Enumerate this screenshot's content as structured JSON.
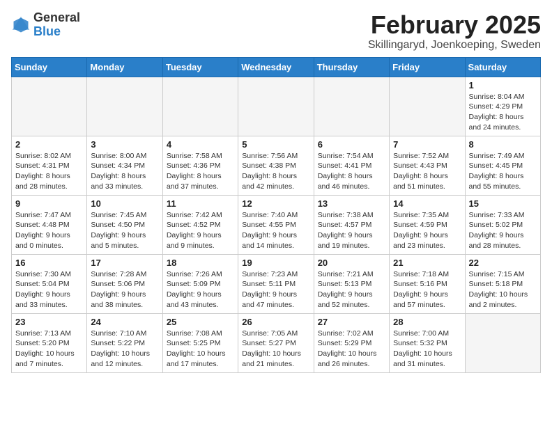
{
  "header": {
    "logo_general": "General",
    "logo_blue": "Blue",
    "title": "February 2025",
    "subtitle": "Skillingaryd, Joenkoeping, Sweden"
  },
  "weekdays": [
    "Sunday",
    "Monday",
    "Tuesday",
    "Wednesday",
    "Thursday",
    "Friday",
    "Saturday"
  ],
  "weeks": [
    [
      {
        "day": "",
        "info": ""
      },
      {
        "day": "",
        "info": ""
      },
      {
        "day": "",
        "info": ""
      },
      {
        "day": "",
        "info": ""
      },
      {
        "day": "",
        "info": ""
      },
      {
        "day": "",
        "info": ""
      },
      {
        "day": "1",
        "info": "Sunrise: 8:04 AM\nSunset: 4:29 PM\nDaylight: 8 hours and 24 minutes."
      }
    ],
    [
      {
        "day": "2",
        "info": "Sunrise: 8:02 AM\nSunset: 4:31 PM\nDaylight: 8 hours and 28 minutes."
      },
      {
        "day": "3",
        "info": "Sunrise: 8:00 AM\nSunset: 4:34 PM\nDaylight: 8 hours and 33 minutes."
      },
      {
        "day": "4",
        "info": "Sunrise: 7:58 AM\nSunset: 4:36 PM\nDaylight: 8 hours and 37 minutes."
      },
      {
        "day": "5",
        "info": "Sunrise: 7:56 AM\nSunset: 4:38 PM\nDaylight: 8 hours and 42 minutes."
      },
      {
        "day": "6",
        "info": "Sunrise: 7:54 AM\nSunset: 4:41 PM\nDaylight: 8 hours and 46 minutes."
      },
      {
        "day": "7",
        "info": "Sunrise: 7:52 AM\nSunset: 4:43 PM\nDaylight: 8 hours and 51 minutes."
      },
      {
        "day": "8",
        "info": "Sunrise: 7:49 AM\nSunset: 4:45 PM\nDaylight: 8 hours and 55 minutes."
      }
    ],
    [
      {
        "day": "9",
        "info": "Sunrise: 7:47 AM\nSunset: 4:48 PM\nDaylight: 9 hours and 0 minutes."
      },
      {
        "day": "10",
        "info": "Sunrise: 7:45 AM\nSunset: 4:50 PM\nDaylight: 9 hours and 5 minutes."
      },
      {
        "day": "11",
        "info": "Sunrise: 7:42 AM\nSunset: 4:52 PM\nDaylight: 9 hours and 9 minutes."
      },
      {
        "day": "12",
        "info": "Sunrise: 7:40 AM\nSunset: 4:55 PM\nDaylight: 9 hours and 14 minutes."
      },
      {
        "day": "13",
        "info": "Sunrise: 7:38 AM\nSunset: 4:57 PM\nDaylight: 9 hours and 19 minutes."
      },
      {
        "day": "14",
        "info": "Sunrise: 7:35 AM\nSunset: 4:59 PM\nDaylight: 9 hours and 23 minutes."
      },
      {
        "day": "15",
        "info": "Sunrise: 7:33 AM\nSunset: 5:02 PM\nDaylight: 9 hours and 28 minutes."
      }
    ],
    [
      {
        "day": "16",
        "info": "Sunrise: 7:30 AM\nSunset: 5:04 PM\nDaylight: 9 hours and 33 minutes."
      },
      {
        "day": "17",
        "info": "Sunrise: 7:28 AM\nSunset: 5:06 PM\nDaylight: 9 hours and 38 minutes."
      },
      {
        "day": "18",
        "info": "Sunrise: 7:26 AM\nSunset: 5:09 PM\nDaylight: 9 hours and 43 minutes."
      },
      {
        "day": "19",
        "info": "Sunrise: 7:23 AM\nSunset: 5:11 PM\nDaylight: 9 hours and 47 minutes."
      },
      {
        "day": "20",
        "info": "Sunrise: 7:21 AM\nSunset: 5:13 PM\nDaylight: 9 hours and 52 minutes."
      },
      {
        "day": "21",
        "info": "Sunrise: 7:18 AM\nSunset: 5:16 PM\nDaylight: 9 hours and 57 minutes."
      },
      {
        "day": "22",
        "info": "Sunrise: 7:15 AM\nSunset: 5:18 PM\nDaylight: 10 hours and 2 minutes."
      }
    ],
    [
      {
        "day": "23",
        "info": "Sunrise: 7:13 AM\nSunset: 5:20 PM\nDaylight: 10 hours and 7 minutes."
      },
      {
        "day": "24",
        "info": "Sunrise: 7:10 AM\nSunset: 5:22 PM\nDaylight: 10 hours and 12 minutes."
      },
      {
        "day": "25",
        "info": "Sunrise: 7:08 AM\nSunset: 5:25 PM\nDaylight: 10 hours and 17 minutes."
      },
      {
        "day": "26",
        "info": "Sunrise: 7:05 AM\nSunset: 5:27 PM\nDaylight: 10 hours and 21 minutes."
      },
      {
        "day": "27",
        "info": "Sunrise: 7:02 AM\nSunset: 5:29 PM\nDaylight: 10 hours and 26 minutes."
      },
      {
        "day": "28",
        "info": "Sunrise: 7:00 AM\nSunset: 5:32 PM\nDaylight: 10 hours and 31 minutes."
      },
      {
        "day": "",
        "info": ""
      }
    ]
  ]
}
